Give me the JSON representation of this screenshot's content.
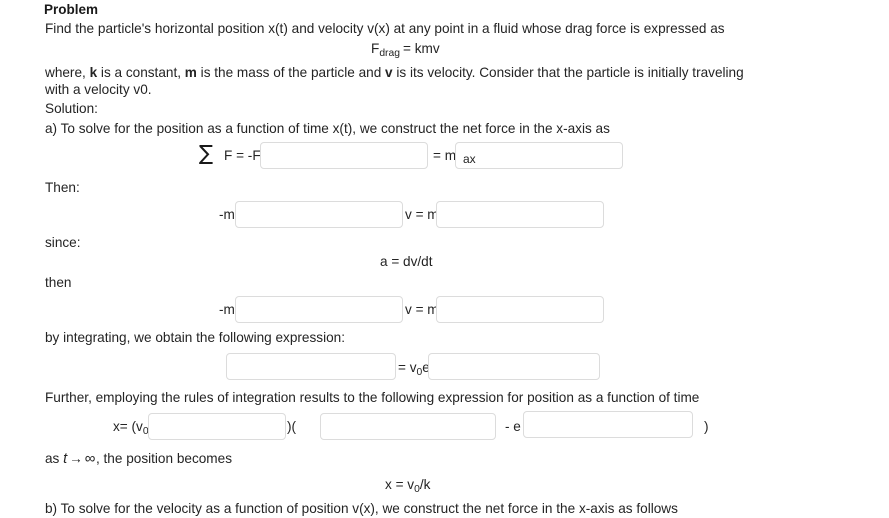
{
  "document": {
    "heading": "Problem",
    "problem_statement": "Find the particle's horizontal position x(t) and velocity v(x) at any point in a fluid whose drag force is expressed as",
    "drag_equation": {
      "symbol": "F",
      "subscript": "drag",
      "rest": "= kmv"
    },
    "where_clause": {
      "part1": "where, ",
      "k": "k",
      "part2": " is a constant, ",
      "m": "m",
      "part3": " is the mass of the particle and ",
      "v": "v",
      "part4": " is its velocity. Consider that the particle is initially traveling with a velocity v0."
    },
    "solution_label": "Solution:",
    "part_a_intro": "a) To solve for the position as a function of time x(t), we construct the net force in the x-axis as",
    "sum_line": {
      "sigma": "∑",
      "lhs": "F = -F",
      "blank1_value": "",
      "blank1_placeholder": "",
      "mid": "= m",
      "blank2_value": "ax",
      "blank2_placeholder": ""
    },
    "then_label": "Then:",
    "then_line": {
      "prefix": "-m",
      "blank1_value": "",
      "mid": "v = m",
      "blank2_value": ""
    },
    "since_label": "since:",
    "accel_equation": "a = dv/dt",
    "then_label_2": "then",
    "then_line_2": {
      "prefix": "-m",
      "blank1_value": "",
      "mid": "v = m",
      "blank2_value": ""
    },
    "integrating_text": "by integrating, we obtain the following expression:",
    "integrate_line": {
      "blank1_value": "",
      "mid_prefix": "= v",
      "mid_sub": "0",
      "mid_suffix": "e",
      "blank2_value": ""
    },
    "further_text": "Further, employing the rules of integration results to the following expression for position as a function of time",
    "position_line": {
      "prefix": "x= (v",
      "prefix_sub": "0",
      "prefix_after": "/",
      "blank1_value": "",
      "sep1": ")(",
      "blank2_value": "",
      "sep2": "- e",
      "blank3_value": "",
      "suffix": ")"
    },
    "limit_line": {
      "prefix": "as ",
      "t": "t",
      "arrow": "→",
      "infinity": "∞",
      "suffix": ", the position becomes"
    },
    "limit_equation": {
      "lhs": "x = v",
      "sub": "0",
      "rhs": "/k"
    },
    "part_b_intro": "b) To solve for the velocity as a function of position v(x), we construct the net force in the x-axis as follows"
  },
  "colors": {
    "text": "#242424",
    "heading": "#1a1a1a",
    "field_border": "#dcdcdc",
    "background": "#ffffff"
  }
}
